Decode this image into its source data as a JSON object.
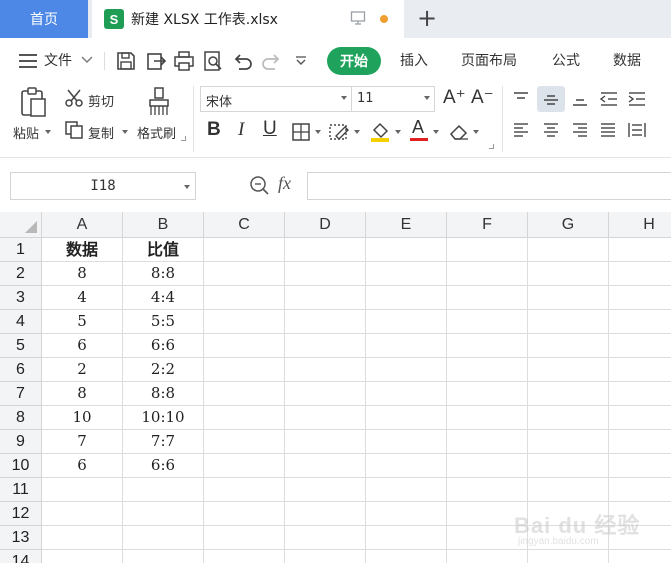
{
  "tabs": {
    "home_label": "首页",
    "doc_icon_letter": "S",
    "doc_title": "新建 XLSX 工作表.xlsx",
    "new_tab_symbol": "+"
  },
  "menu": {
    "file_label": "文件",
    "items": [
      "开始",
      "插入",
      "页面布局",
      "公式",
      "数据"
    ]
  },
  "ribbon": {
    "paste": "粘贴",
    "cut": "剪切",
    "copy": "复制",
    "format_painter": "格式刷",
    "font_name": "宋体",
    "font_size": "11",
    "bold": "B",
    "italic": "I",
    "underline": "U",
    "font_color_glyph": "A",
    "grow_font": "A⁺",
    "shrink_font": "A⁻"
  },
  "formula_bar": {
    "cell_ref": "I18",
    "fx": "fx",
    "formula_value": ""
  },
  "sheet": {
    "columns": [
      "A",
      "B",
      "C",
      "D",
      "E",
      "F",
      "G",
      "H"
    ],
    "row_numbers": [
      "1",
      "2",
      "3",
      "4",
      "5",
      "6",
      "7",
      "8",
      "9",
      "10",
      "11",
      "12",
      "13",
      "14"
    ],
    "rows": [
      [
        "数据",
        "比值"
      ],
      [
        "8",
        "8:8"
      ],
      [
        "4",
        "4:4"
      ],
      [
        "5",
        "5:5"
      ],
      [
        "6",
        "6:6"
      ],
      [
        "2",
        "2:2"
      ],
      [
        "8",
        "8:8"
      ],
      [
        "10",
        "10:10"
      ],
      [
        "7",
        "7:7"
      ],
      [
        "6",
        "6:6"
      ],
      [
        "",
        ""
      ],
      [
        "",
        ""
      ],
      [
        "",
        ""
      ],
      [
        "",
        ""
      ]
    ]
  },
  "watermark": {
    "text": "Bai du 经验",
    "sub": "jingyan.baidu.com"
  },
  "colors": {
    "home_tab": "#4d88e6",
    "start_tab": "#1fa35c",
    "xlsx_icon": "#1f9d55",
    "unsaved_dot": "#f0a030",
    "font_color_bar": "#e02020",
    "fill_color_bar": "#f5d000"
  }
}
